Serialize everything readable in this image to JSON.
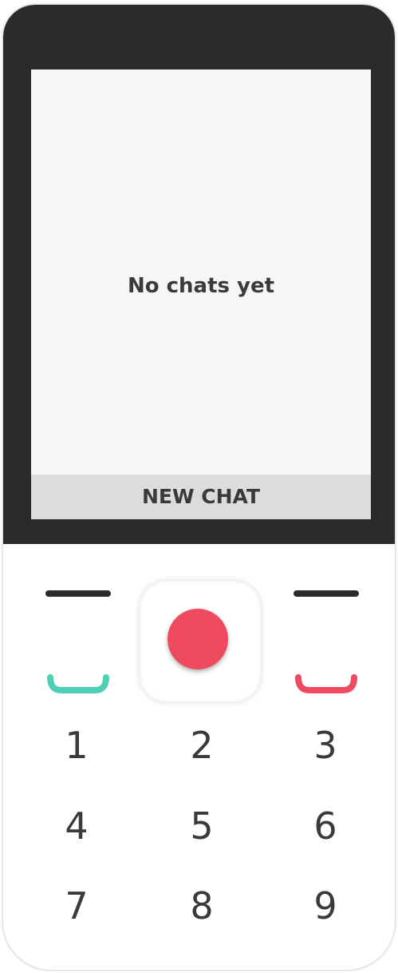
{
  "screen": {
    "empty_message": "No chats yet",
    "softkey_center": "NEW CHAT"
  },
  "keypad": {
    "softkey_left_icon": "left-softkey-icon",
    "softkey_right_icon": "right-softkey-icon",
    "dpad_center_icon": "select-button-icon",
    "call_icon": "call-icon",
    "end_call_icon": "end-call-icon",
    "digits": [
      "1",
      "2",
      "3",
      "4",
      "5",
      "6",
      "7",
      "8",
      "9"
    ]
  },
  "colors": {
    "body_dark": "#2b2b2b",
    "screen_bg": "#f6f6f6",
    "softkey_bar": "#dcdcdc",
    "text": "#3a3a3a",
    "dpad_center": "#ee4a60",
    "call_green": "#4fd0b6",
    "end_red": "#ee4a60"
  }
}
